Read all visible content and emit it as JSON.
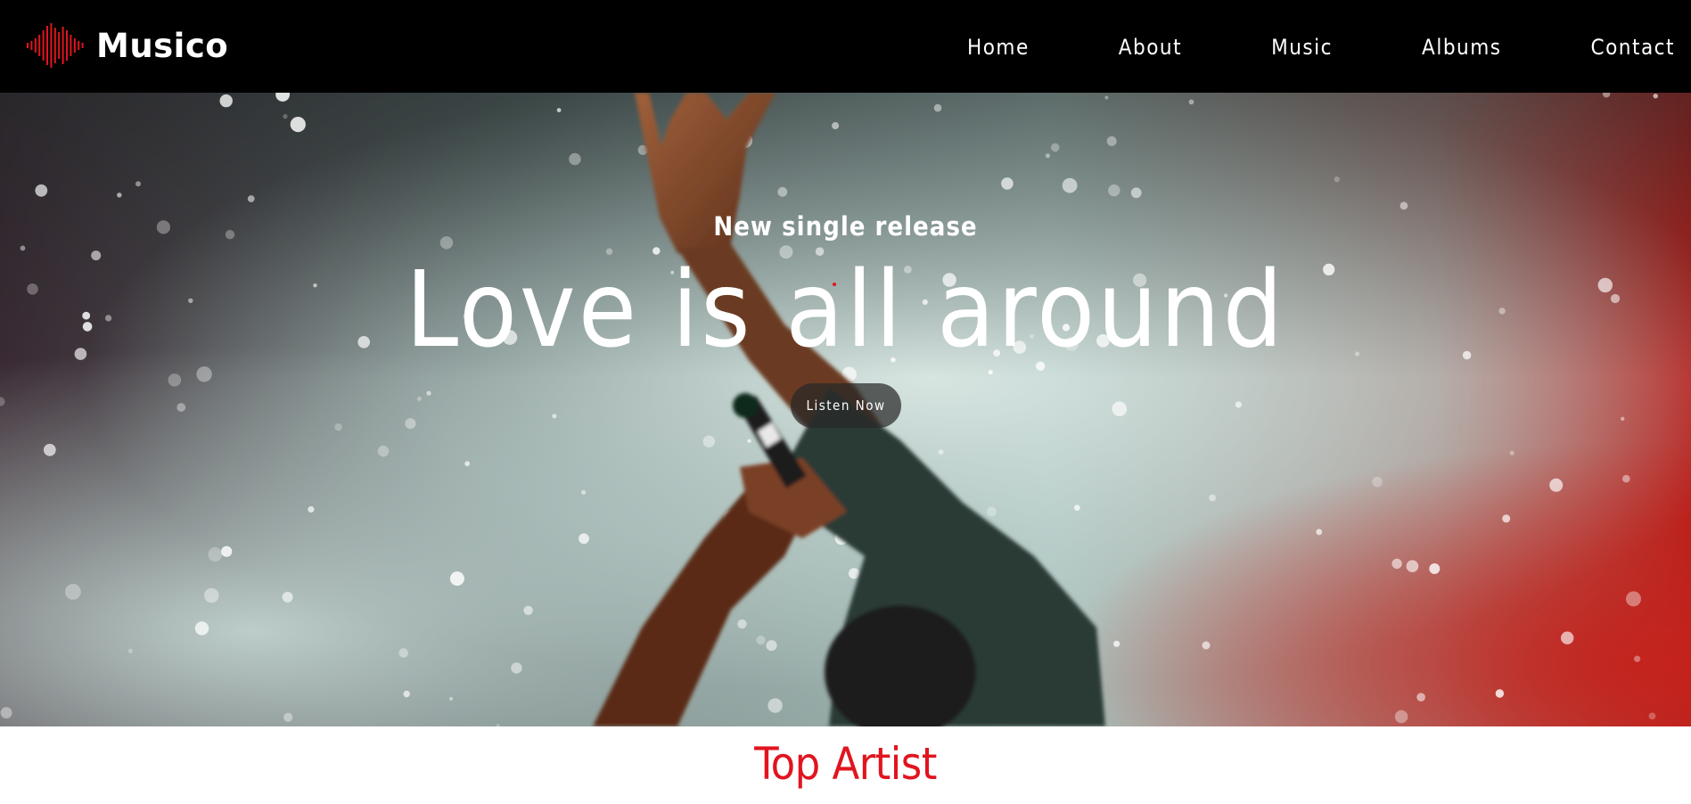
{
  "brand": {
    "name": "Musico",
    "icon": "sound-wave-icon",
    "accent_color": "#e0151f"
  },
  "nav": {
    "items": [
      {
        "label": "Home"
      },
      {
        "label": "About"
      },
      {
        "label": "Music"
      },
      {
        "label": "Albums"
      },
      {
        "label": "Contact"
      }
    ]
  },
  "hero": {
    "eyebrow": "New single release",
    "title": "Love is all around",
    "button_label": "Listen Now",
    "image": "concert-performer-with-microphone"
  },
  "section": {
    "title": "Top Artist"
  }
}
